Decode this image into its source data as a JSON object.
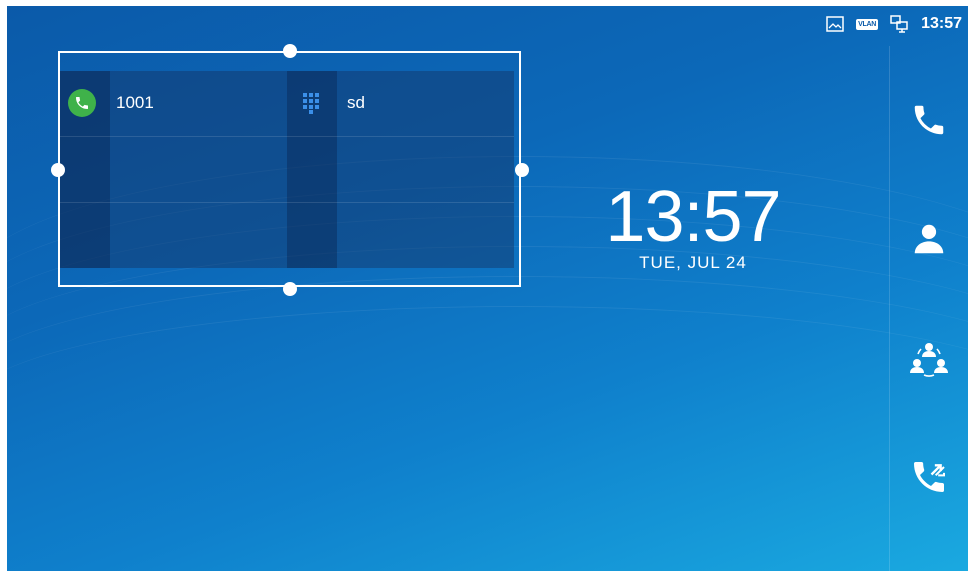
{
  "status_bar": {
    "icons": [
      "screenshot-icon",
      "vlan-icon",
      "network-icon"
    ],
    "vlan_label": "VLAN",
    "time": "13:57"
  },
  "widget": {
    "entries": [
      {
        "label": "1001",
        "icon": "phone-call-icon",
        "icon_color": "#3fb24a"
      },
      {
        "label": "sd",
        "icon": "dialpad-icon",
        "icon_color": "#3b8fe8"
      }
    ]
  },
  "clock": {
    "time": "13:57",
    "date": "TUE, JUL 24"
  },
  "dock": {
    "items": [
      {
        "icon": "phone-icon"
      },
      {
        "icon": "contact-icon"
      },
      {
        "icon": "conference-icon"
      },
      {
        "icon": "call-transfer-icon"
      }
    ]
  },
  "colors": {
    "background_top": "#0b5aa9",
    "background_bottom": "#1aa9e0",
    "call_green": "#3fb24a"
  }
}
